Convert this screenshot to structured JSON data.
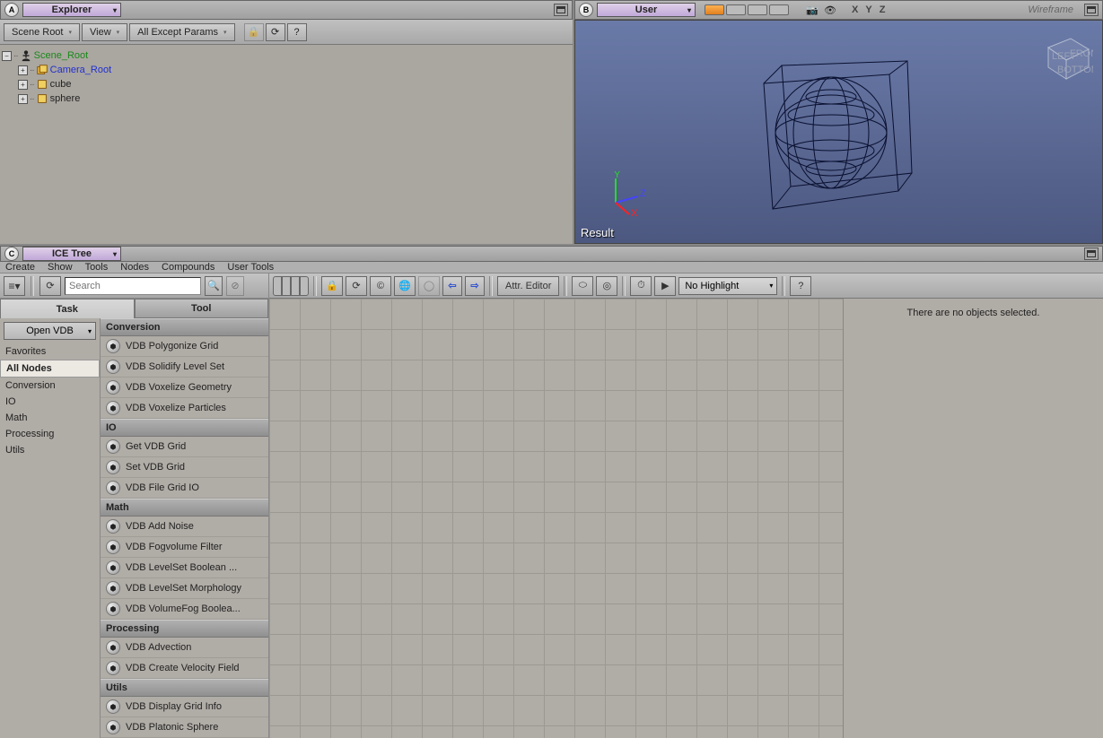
{
  "panelA": {
    "badge": "A",
    "title": "Explorer"
  },
  "panelB": {
    "badge": "B",
    "title": "User",
    "shading": "Wireframe",
    "result": "Result",
    "axes": [
      "X",
      "Y",
      "Z"
    ]
  },
  "panelC": {
    "badge": "C",
    "title": "ICE Tree"
  },
  "explorer": {
    "toolbar": {
      "scene_root": "Scene Root",
      "view": "View",
      "filter": "All Except Params",
      "lock": "🔒",
      "refresh": "⟳",
      "help": "?"
    },
    "tree": {
      "root": "Scene_Root",
      "children": [
        {
          "name": "Camera_Root",
          "cls": "camera"
        },
        {
          "name": "cube",
          "cls": "obj"
        },
        {
          "name": "sphere",
          "cls": "obj"
        }
      ]
    }
  },
  "ice": {
    "menus": [
      "Create",
      "Show",
      "Tools",
      "Nodes",
      "Compounds",
      "User Tools"
    ],
    "toolbar": {
      "search_placeholder": "Search",
      "attr_editor": "Attr. Editor",
      "highlight": "No Highlight"
    },
    "tabs": {
      "task": "Task",
      "tool": "Tool"
    },
    "category_combo": "Open VDB",
    "categories": [
      "Favorites",
      "All Nodes",
      "Conversion",
      "IO",
      "Math",
      "Processing",
      "Utils"
    ],
    "active_category": "All Nodes",
    "groups": [
      {
        "title": "Conversion",
        "nodes": [
          "VDB Polygonize Grid",
          "VDB Solidify Level Set",
          "VDB Voxelize Geometry",
          "VDB Voxelize Particles"
        ]
      },
      {
        "title": "IO",
        "nodes": [
          "Get VDB Grid",
          "Set VDB Grid",
          "VDB File Grid IO"
        ]
      },
      {
        "title": "Math",
        "nodes": [
          "VDB Add Noise",
          "VDB Fogvolume Filter",
          "VDB LevelSet Boolean ...",
          "VDB LevelSet Morphology",
          "VDB VolumeFog Boolea..."
        ]
      },
      {
        "title": "Processing",
        "nodes": [
          "VDB Advection",
          "VDB Create Velocity Field"
        ]
      },
      {
        "title": "Utils",
        "nodes": [
          "VDB Display Grid Info",
          "VDB Platonic Sphere"
        ]
      }
    ],
    "right_status": "There are no objects selected."
  }
}
